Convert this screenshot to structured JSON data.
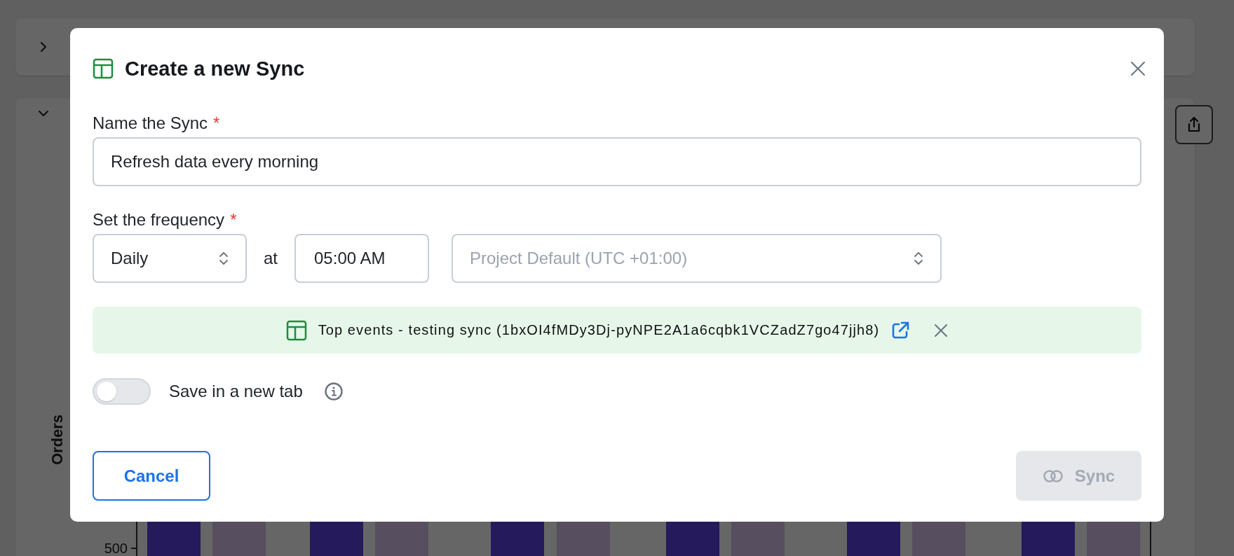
{
  "background": {
    "panels": [
      {
        "expanded": false
      },
      {
        "expanded": true
      }
    ],
    "chart": {
      "axis_label": "Orders",
      "y_tick": "500"
    }
  },
  "dialog": {
    "title": "Create a new Sync",
    "name_field": {
      "label": "Name the Sync",
      "required_mark": "*",
      "value": "Refresh data every morning"
    },
    "frequency": {
      "label": "Set the frequency",
      "required_mark": "*",
      "period": "Daily",
      "at_label": "at",
      "time": "05:00 AM",
      "timezone": {
        "placeholder": "Project Default (UTC +01:00)"
      }
    },
    "linked_sheet": {
      "text": "Top events - testing sync (1bxOI4fMDy3Dj-pyNPE2A1a6cqbk1VCZadZ7go47jjh8)"
    },
    "new_tab": {
      "label": "Save in a new tab",
      "on": false
    },
    "buttons": [
      {
        "kind": "cancel",
        "label": "Cancel",
        "disabled": false
      },
      {
        "kind": "sync",
        "label": "Sync",
        "disabled": true
      }
    ]
  }
}
